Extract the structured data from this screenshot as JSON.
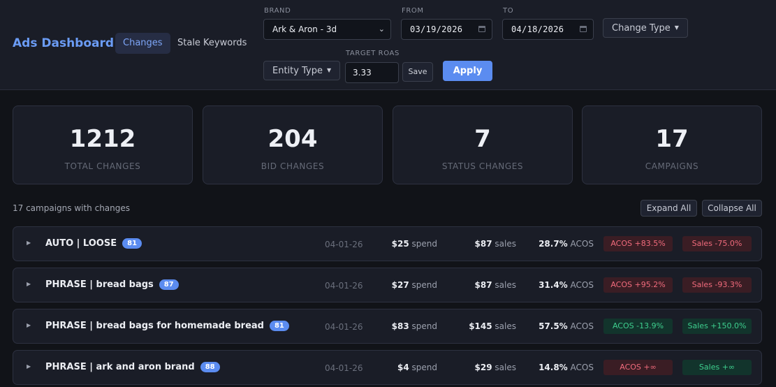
{
  "header": {
    "title": "Ads Dashboard",
    "tabs": [
      {
        "label": "Changes",
        "active": true
      },
      {
        "label": "Stale Keywords",
        "active": false
      }
    ]
  },
  "filters": {
    "brand": {
      "label": "BRAND",
      "value": "Ark & Aron - 3d"
    },
    "from": {
      "label": "FROM",
      "value": "03/19/2026"
    },
    "to": {
      "label": "TO",
      "value": "04/18/2026"
    },
    "change_type": {
      "label": "Change Type"
    },
    "entity_type": {
      "label": "Entity Type"
    },
    "target_roas": {
      "label": "TARGET ROAS",
      "value": "3.33"
    },
    "save_label": "Save",
    "apply_label": "Apply"
  },
  "stats": [
    {
      "value": "1212",
      "label": "TOTAL CHANGES"
    },
    {
      "value": "204",
      "label": "BID CHANGES"
    },
    {
      "value": "7",
      "label": "STATUS CHANGES"
    },
    {
      "value": "17",
      "label": "CAMPAIGNS"
    }
  ],
  "list": {
    "summary": "17 campaigns with changes",
    "expand_all": "Expand All",
    "collapse_all": "Collapse All"
  },
  "campaigns": [
    {
      "name": "AUTO | LOOSE",
      "count": "81",
      "date": "04-01-26",
      "spend": "$25",
      "spend_unit": "spend",
      "sales": "$87",
      "sales_unit": "sales",
      "acos": "28.7%",
      "acos_unit": "ACOS",
      "acos_change": "ACOS +83.5%",
      "acos_status": "bad",
      "sales_change": "Sales -75.0%",
      "sales_status": "bad"
    },
    {
      "name": "PHRASE | bread bags",
      "count": "87",
      "date": "04-01-26",
      "spend": "$27",
      "spend_unit": "spend",
      "sales": "$87",
      "sales_unit": "sales",
      "acos": "31.4%",
      "acos_unit": "ACOS",
      "acos_change": "ACOS +95.2%",
      "acos_status": "bad",
      "sales_change": "Sales -93.3%",
      "sales_status": "bad"
    },
    {
      "name": "PHRASE | bread bags for homemade bread",
      "count": "81",
      "date": "04-01-26",
      "spend": "$83",
      "spend_unit": "spend",
      "sales": "$145",
      "sales_unit": "sales",
      "acos": "57.5%",
      "acos_unit": "ACOS",
      "acos_change": "ACOS -13.9%",
      "acos_status": "good",
      "sales_change": "Sales +150.0%",
      "sales_status": "good"
    },
    {
      "name": "PHRASE | ark and aron brand",
      "count": "88",
      "date": "04-01-26",
      "spend": "$4",
      "spend_unit": "spend",
      "sales": "$29",
      "sales_unit": "sales",
      "acos": "14.8%",
      "acos_unit": "ACOS",
      "acos_change": "ACOS +∞",
      "acos_status": "bad",
      "sales_change": "Sales +∞",
      "sales_status": "good"
    }
  ],
  "colors": {
    "background": "#111318",
    "panel": "#1a1d27",
    "accent": "#5b8cf0",
    "title_blue": "#6b9cf5",
    "negative": "#f16b7c",
    "positive": "#3ecf8e"
  },
  "icons": {
    "select_chevron": "chevron-down-icon",
    "calendar": "calendar-icon",
    "dropdown_caret": "caret-down-icon",
    "row_expand": "expand-arrow-icon"
  }
}
